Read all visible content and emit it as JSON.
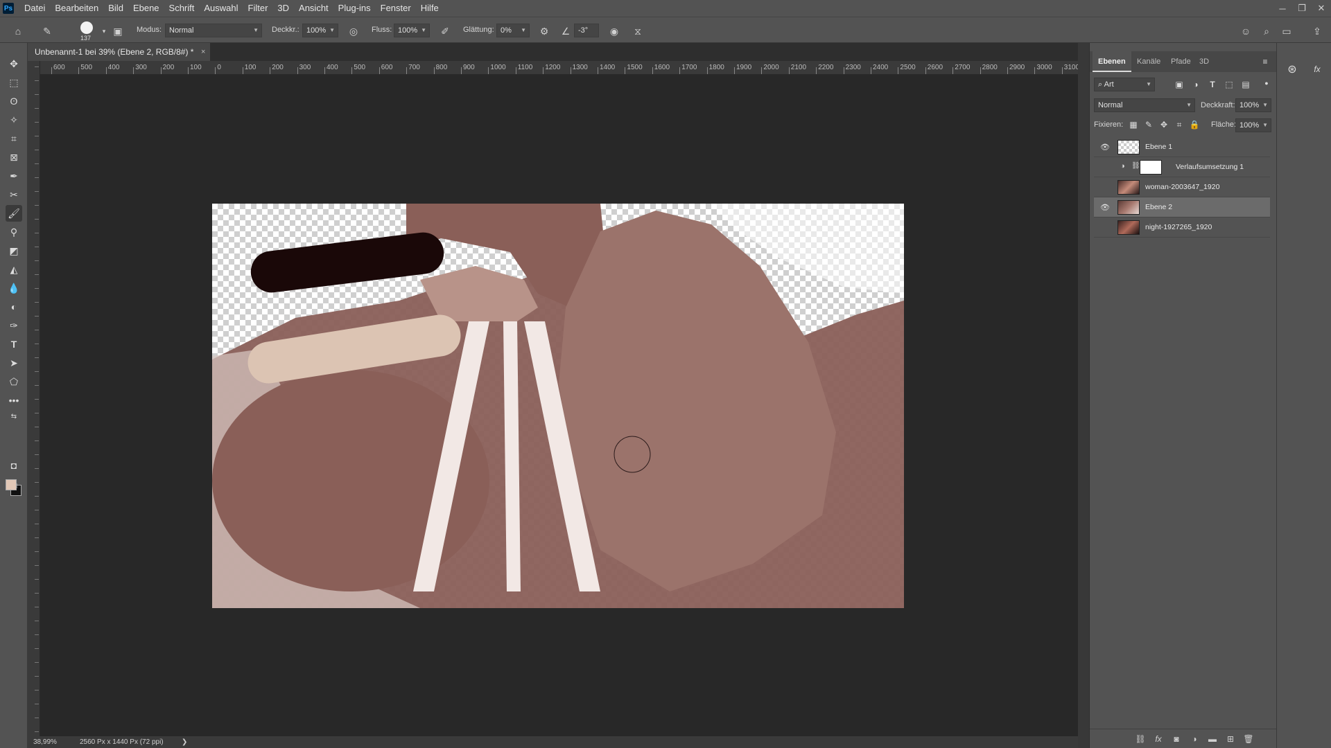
{
  "app": {
    "logo": "Ps"
  },
  "menu": [
    "Datei",
    "Bearbeiten",
    "Bild",
    "Ebene",
    "Schrift",
    "Auswahl",
    "Filter",
    "3D",
    "Ansicht",
    "Plug-ins",
    "Fenster",
    "Hilfe"
  ],
  "window_controls": {
    "minimize": "─",
    "restore": "❐",
    "close": "✕"
  },
  "options": {
    "brush_size": "137",
    "mode_label": "Modus:",
    "mode_value": "Normal",
    "opacity_label": "Deckkr.:",
    "opacity_value": "100%",
    "flow_label": "Fluss:",
    "flow_value": "100%",
    "smoothing_label": "Glättung:",
    "smoothing_value": "0%",
    "angle_value": "-3°"
  },
  "document": {
    "tab_title": "Unbenannt-1 bei 39% (Ebene 2, RGB/8#) *",
    "tab_close": "×"
  },
  "ruler_top_labels": [
    "600",
    "500",
    "400",
    "300",
    "200",
    "100",
    "0",
    "100",
    "200",
    "300",
    "400",
    "500",
    "600",
    "700",
    "800",
    "900",
    "1000",
    "1100",
    "1200",
    "1300",
    "1400",
    "1500",
    "1600",
    "1700",
    "1800",
    "1900",
    "2000",
    "2100",
    "2200",
    "2300",
    "2400",
    "2500",
    "2600",
    "2700",
    "2800",
    "2900",
    "3000",
    "3100"
  ],
  "status": {
    "zoom": "38,99%",
    "doc_size": "2560 Px x 1440 Px (72 ppi)",
    "arrow": "❯"
  },
  "layers_panel": {
    "tabs": [
      "Ebenen",
      "Kanäle",
      "Pfade",
      "3D"
    ],
    "filter_kind": "Art",
    "blend_mode": "Normal",
    "opacity_label": "Deckkraft:",
    "opacity_value": "100%",
    "lock_label": "Fixieren:",
    "fill_label": "Fläche:",
    "fill_value": "100%",
    "layers": [
      {
        "name": "Ebene 1",
        "visible": true,
        "selected": false,
        "thumb": "checker"
      },
      {
        "name": "Verlaufsumsetzung 1",
        "visible": false,
        "selected": false,
        "thumb": "adjustment"
      },
      {
        "name": "woman-2003647_1920",
        "visible": false,
        "selected": false,
        "thumb": "photo"
      },
      {
        "name": "Ebene 2",
        "visible": true,
        "selected": true,
        "thumb": "photo"
      },
      {
        "name": "night-1927265_1920",
        "visible": false,
        "selected": false,
        "thumb": "photo"
      }
    ]
  },
  "colors": {
    "foreground": "#e2c8b6",
    "background": "#111111",
    "duotone": "#8a5f58",
    "dark_stroke": "#1a0808",
    "light_stroke": "#dcc4b3"
  }
}
